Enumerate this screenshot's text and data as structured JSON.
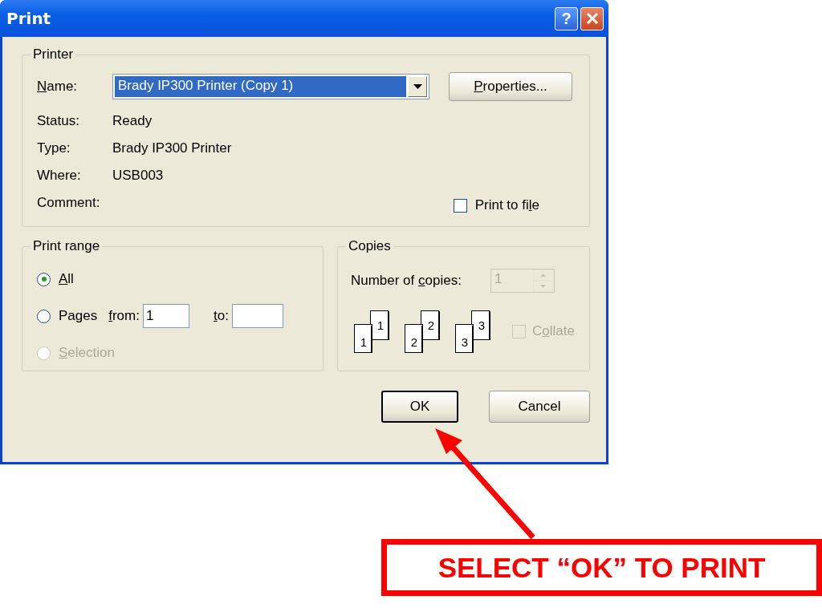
{
  "window": {
    "title": "Print",
    "help_button": "?"
  },
  "printer": {
    "title": "Printer",
    "name_label": {
      "key": "N",
      "tail": "ame:"
    },
    "name_value": "Brady IP300 Printer (Copy 1)",
    "properties_button": {
      "key": "P",
      "tail": "roperties..."
    },
    "info": [
      {
        "label": "Status:",
        "value": "Ready"
      },
      {
        "label": "Type:",
        "value": "Brady IP300 Printer"
      },
      {
        "label": "Where:",
        "value": "USB003"
      },
      {
        "label": "Comment:"
      }
    ],
    "print_to_file": {
      "lead": "Print to fi",
      "key": "l",
      "tail": "e",
      "checked": false
    }
  },
  "print_range": {
    "title": "Print range",
    "options": [
      {
        "kind": "all",
        "key": "A",
        "tail": "ll",
        "selected": true,
        "disabled": false
      },
      {
        "kind": "pages",
        "lead": "Pages",
        "selected": false,
        "disabled": false
      },
      {
        "kind": "selection",
        "key": "S",
        "tail": "election",
        "selected": false,
        "disabled": true
      }
    ],
    "from": {
      "key": "f",
      "tail": "rom:",
      "value": "1"
    },
    "to": {
      "key": "t",
      "tail": "o:"
    }
  },
  "copies": {
    "title": "Copies",
    "count_label": {
      "lead": "Number of ",
      "key": "c",
      "tail": "opies:"
    },
    "count_value": "1",
    "count_disabled": true,
    "stacks": [
      {
        "front": "1",
        "back": "1"
      },
      {
        "front": "2",
        "back": "2"
      },
      {
        "front": "3",
        "back": "3"
      }
    ],
    "collate": {
      "lead": "C",
      "key": "o",
      "tail": "llate",
      "checked": false,
      "disabled": true
    }
  },
  "buttons": [
    {
      "text": "OK",
      "default": true
    },
    {
      "text": "Cancel",
      "default": false
    }
  ],
  "annotation": {
    "text": "SELECT “OK” TO PRINT"
  }
}
